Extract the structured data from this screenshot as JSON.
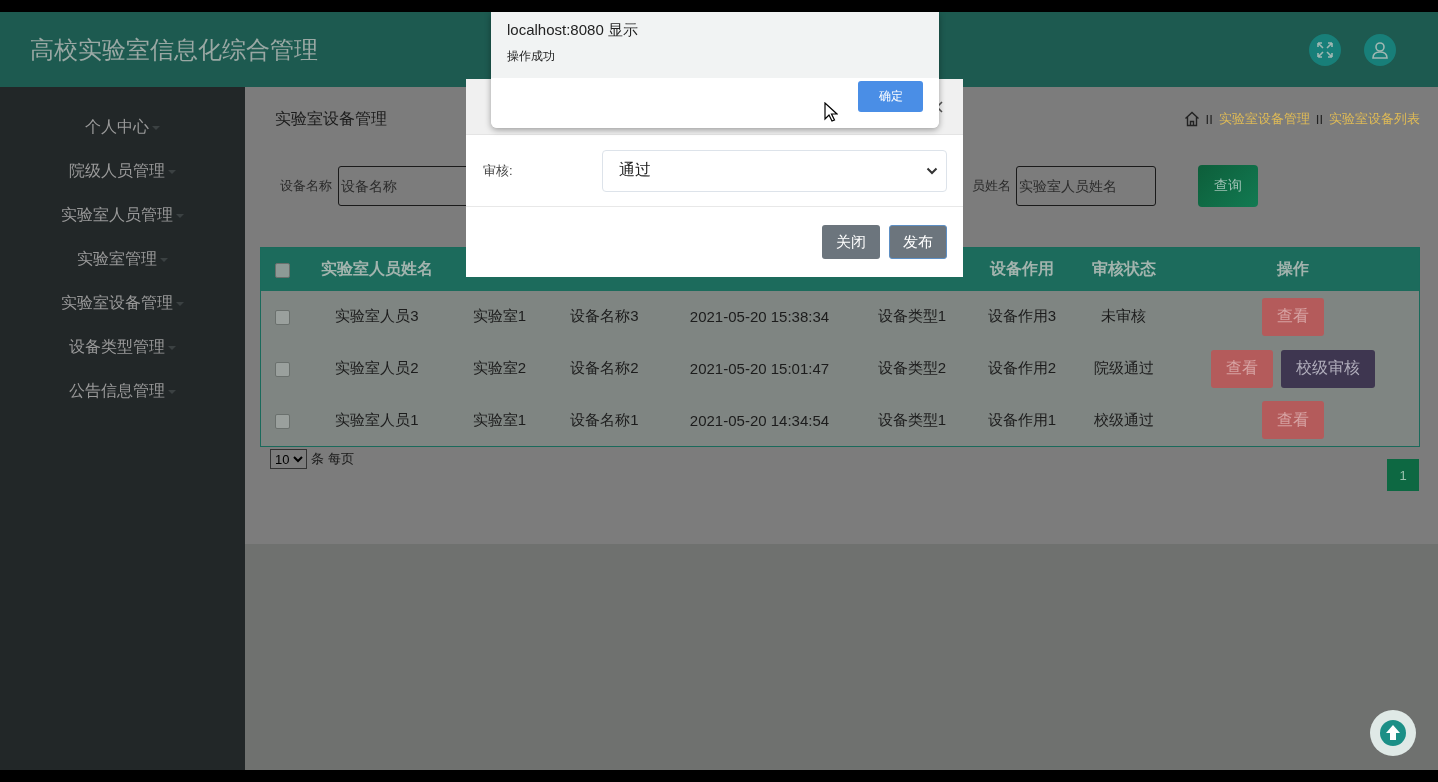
{
  "header": {
    "title": "高校实验室信息化综合管理"
  },
  "sidebar": {
    "items": [
      {
        "label": "个人中心"
      },
      {
        "label": "院级人员管理"
      },
      {
        "label": "实验室人员管理"
      },
      {
        "label": "实验室管理"
      },
      {
        "label": "实验室设备管理"
      },
      {
        "label": "设备类型管理"
      },
      {
        "label": "公告信息管理"
      }
    ]
  },
  "page": {
    "title": "实验室设备管理",
    "breadcrumb": [
      {
        "separator": "II",
        "label": "实验室设备管理"
      },
      {
        "separator": "II",
        "label": "实验室设备列表"
      }
    ]
  },
  "filters": [
    {
      "label": "设备名称",
      "placeholder": "设备名称"
    },
    {
      "label": "员姓名",
      "placeholder": "实验室人员姓名"
    }
  ],
  "search_button": "查询",
  "table": {
    "select_all_checked": false,
    "columns": [
      {
        "label": "实验室人员姓名"
      },
      {
        "covered": true
      },
      {
        "covered": true
      },
      {
        "covered": true
      },
      {
        "covered": true
      },
      {
        "label": "设备作用"
      },
      {
        "label": "审核状态"
      },
      {
        "label": "操作"
      }
    ],
    "rows": [
      {
        "checked": false,
        "cells": [
          "实验室人员3",
          "实验室1",
          "设备名称3",
          "2021-05-20 15:38:34",
          "设备类型1",
          "设备作用3",
          "未审核"
        ],
        "actions": [
          {
            "kind": "view",
            "label": "查看"
          }
        ]
      },
      {
        "checked": false,
        "cells": [
          "实验室人员2",
          "实验室2",
          "设备名称2",
          "2021-05-20 15:01:47",
          "设备类型2",
          "设备作用2",
          "院级通过"
        ],
        "actions": [
          {
            "kind": "view",
            "label": "查看"
          },
          {
            "kind": "review",
            "label": "校级审核"
          }
        ]
      },
      {
        "checked": false,
        "cells": [
          "实验室人员1",
          "实验室1",
          "设备名称1",
          "2021-05-20 14:34:54",
          "设备类型1",
          "设备作用1",
          "校级通过"
        ],
        "actions": [
          {
            "kind": "view",
            "label": "查看"
          }
        ]
      }
    ]
  },
  "pagination": {
    "page_size": "10",
    "page_size_label": "条 每页",
    "pages": [
      {
        "label": "1",
        "selected": true
      }
    ]
  },
  "modal": {
    "field_label": "审核:",
    "field_value": "通过",
    "buttons": [
      {
        "kind": "close",
        "label": "关闭"
      },
      {
        "kind": "publish",
        "label": "发布"
      }
    ]
  },
  "alert": {
    "origin": "localhost:8080 显示",
    "message": "操作成功",
    "button": "确定"
  }
}
